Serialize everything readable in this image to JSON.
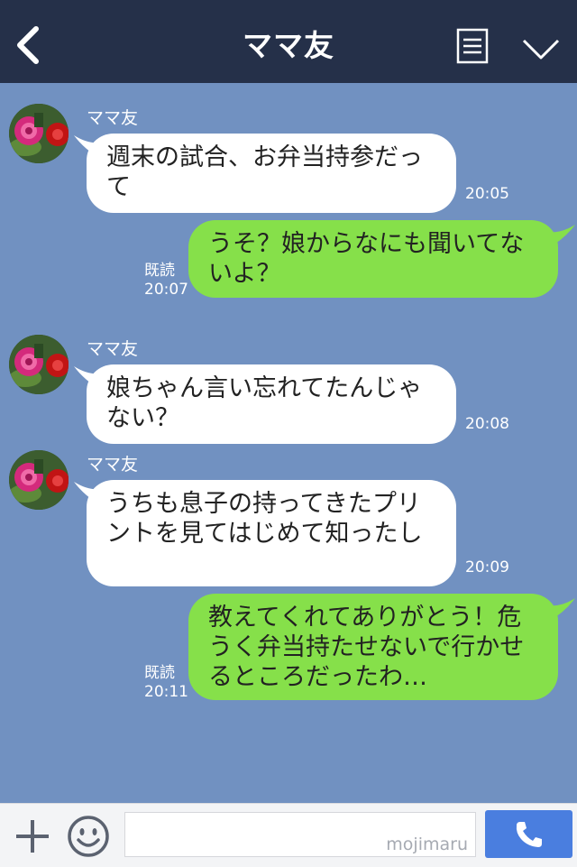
{
  "header": {
    "title": "ママ友"
  },
  "messages": [
    {
      "sender": "ママ友",
      "text": "週末の試合、お弁当持参だって",
      "time": "20:05"
    },
    {
      "read": "既読",
      "time": "20:07",
      "text": "うそ？娘からなにも聞いてないよ？"
    },
    {
      "sender": "ママ友",
      "text": "娘ちゃん言い忘れてたんじゃない？",
      "time": "20:08"
    },
    {
      "sender": "ママ友",
      "text": "うちも息子の持ってきたプリントを見てはじめて知ったし",
      "time": "20:09"
    },
    {
      "read": "既読",
      "time": "20:11",
      "text": "教えてくれてありがとう！危うく弁当持たせないで行かせるところだったわ…"
    }
  ],
  "footer": {
    "watermark": "mojimaru"
  },
  "colors": {
    "header": "#253049",
    "background": "#7191c1",
    "outgoing": "#86e04a",
    "incoming": "#ffffff",
    "call": "#4a7edf"
  }
}
